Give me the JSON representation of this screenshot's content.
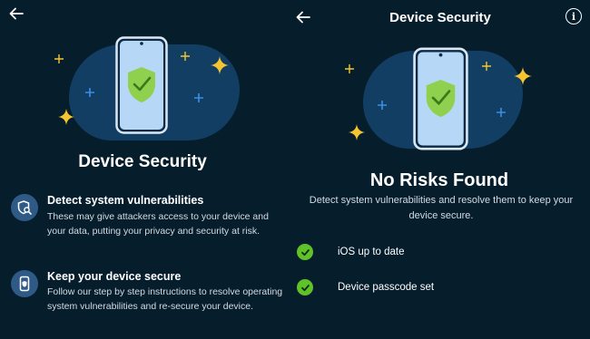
{
  "left_panel": {
    "hero_title": "Device Security",
    "features": [
      {
        "icon": "shield-search-icon",
        "title": "Detect system vulnerabilities",
        "description": "These may give attackers access to your device and your data, putting your privacy and security at risk."
      },
      {
        "icon": "phone-shield-icon",
        "title": "Keep your device secure",
        "description": "Follow our step by step instructions to resolve operating system vulnerabilities and re-secure your device."
      }
    ]
  },
  "right_panel": {
    "header_title": "Device Security",
    "info_glyph": "i",
    "result_title": "No Risks Found",
    "result_description": "Detect system vulnerabilities and resolve them to keep your device secure.",
    "checks": [
      {
        "label": "iOS up to date",
        "status": "passed"
      },
      {
        "label": "Device passcode set",
        "status": "passed"
      }
    ]
  },
  "colors": {
    "background": "#061d2c",
    "blob": "#133e63",
    "shield": "#8fd14f",
    "check": "#5fc228",
    "sparkle": "#f4c531",
    "small_star": "#3a8ee6",
    "icon_circle": "#2f5a86"
  }
}
